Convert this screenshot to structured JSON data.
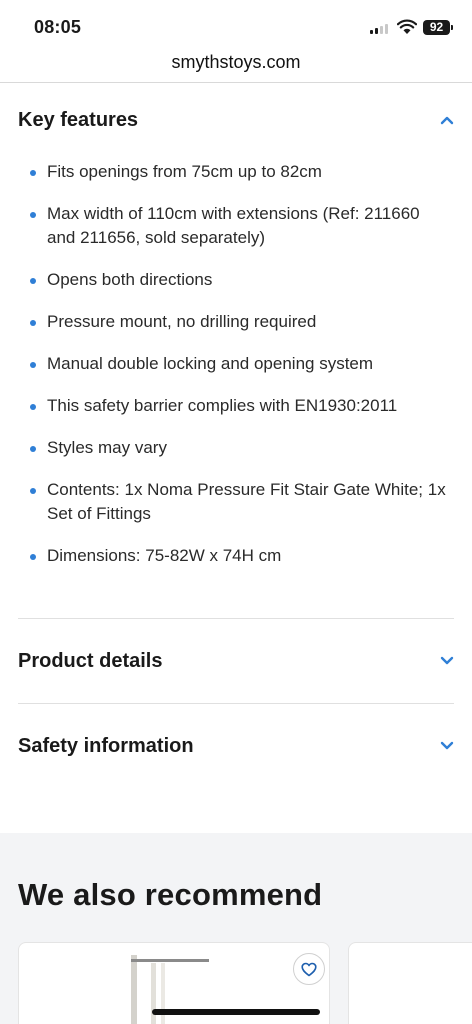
{
  "status_bar": {
    "time": "08:05",
    "battery": "92"
  },
  "browser": {
    "url": "smythstoys.com"
  },
  "key_features": {
    "title": "Key features",
    "items": [
      "Fits openings from 75cm up to 82cm",
      "Max width of 110cm with extensions (Ref: 211660 and 211656, sold separately)",
      "Opens both directions",
      "Pressure mount, no drilling required",
      "Manual double locking and opening system",
      "This safety barrier complies with EN1930:2011",
      "Styles may vary",
      "Contents: 1x Noma Pressure Fit Stair Gate White; 1x Set of Fittings",
      "Dimensions: 75-82W x 74H cm"
    ]
  },
  "product_details": {
    "title": "Product details"
  },
  "safety_information": {
    "title": "Safety information"
  },
  "recommend": {
    "title": "We also recommend"
  },
  "colors": {
    "accent": "#2f7fd6",
    "text": "#1a1a1a",
    "section_bg": "#f3f4f6"
  },
  "icons": {
    "expanded": "chevron-up-icon",
    "collapsed": "chevron-down-icon",
    "favorite": "heart-icon"
  }
}
